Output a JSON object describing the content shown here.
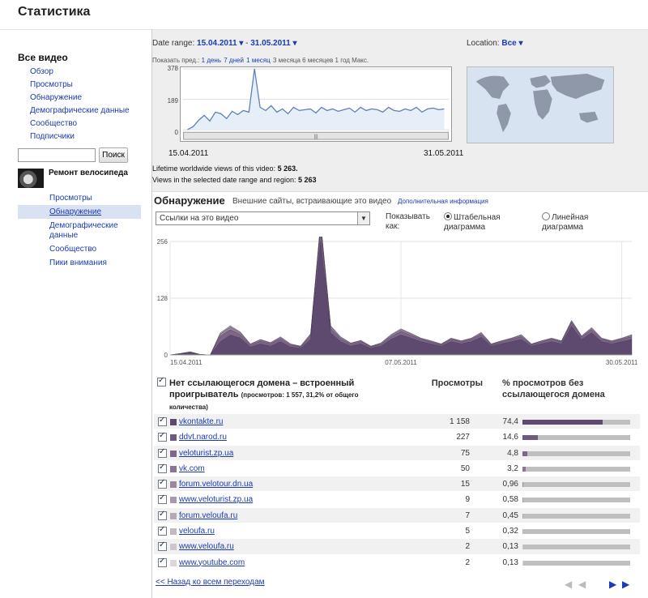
{
  "page_title": "Статистика",
  "sidebar": {
    "heading": "Все видео",
    "items": [
      "Обзор",
      "Просмотры",
      "Обнаружение",
      "Демографические данные",
      "Сообщество",
      "Подписчики"
    ],
    "search_placeholder": "",
    "search_button": "Поиск",
    "video_title": "Ремонт велосипеда",
    "sub_items": [
      "Просмотры",
      "Обнаружение",
      "Демографические данные",
      "Сообщество",
      "Пики внимания"
    ],
    "active_sub": "Обнаружение"
  },
  "top": {
    "date_range_label": "Date range:",
    "date_from": "15.04.2011",
    "date_sep": " - ",
    "date_to": "31.05.2011",
    "location_label": "Location:",
    "location_value": "Все",
    "preset_label": "Показать пред.:",
    "presets": [
      "1 день",
      "7 дней",
      "1 месяц"
    ],
    "presets_plain": "3 месяца 6 месяцев 1 год Макс.",
    "spark_y": [
      "378",
      "189",
      "0"
    ],
    "spark_values": [
      2,
      20,
      60,
      90,
      55,
      110,
      100,
      70,
      115,
      95,
      120,
      110,
      378,
      140,
      120,
      150,
      110,
      130,
      100,
      140,
      120,
      125,
      130,
      105,
      140,
      120,
      130,
      115,
      125,
      135,
      110,
      140,
      120,
      130,
      125,
      110,
      140,
      120,
      115,
      130,
      120,
      140,
      110,
      130,
      135,
      125,
      130
    ],
    "date_left": "15.04.2011",
    "date_right": "31.05.2011",
    "lifetime_label": "Lifetime worldwide views of this video:",
    "lifetime_value": "5 263.",
    "inrange_label": "Views in the selected date range and region:",
    "inrange_value": "5 263"
  },
  "discovery": {
    "title": "Обнаружение",
    "subtitle": "Внешние сайты, встраивающие это видео",
    "more_link": "Дополнительная информация",
    "select_value": "Ссылки на это видео",
    "show_as": "Показывать как:",
    "opt_stacked": "Штабельная диаграмма",
    "opt_line": "Линейная диаграмма"
  },
  "chart_data": {
    "type": "area",
    "stacked": true,
    "y_ticks": [
      "256",
      "128",
      "0"
    ],
    "ylim": [
      0,
      256
    ],
    "x_labels": [
      "15.04.2011",
      "07.05.2011",
      "30.05.2011"
    ],
    "colors": [
      "#5e4a6e",
      "#7d6689",
      "#9a889f",
      "#b1a5b3"
    ],
    "series": [
      {
        "values": [
          0,
          2,
          4,
          1,
          0,
          30,
          45,
          38,
          18,
          25,
          20,
          30,
          18,
          15,
          35,
          256,
          50,
          30,
          20,
          25,
          15,
          20,
          35,
          45,
          38,
          30,
          25,
          20,
          30,
          25,
          30,
          40,
          20,
          25,
          30,
          35,
          20,
          25,
          30,
          25,
          65,
          35,
          50,
          30,
          25,
          30,
          35
        ]
      },
      {
        "values": [
          0,
          1,
          2,
          0,
          0,
          12,
          12,
          8,
          4,
          6,
          5,
          6,
          4,
          3,
          8,
          30,
          10,
          6,
          4,
          5,
          3,
          4,
          6,
          8,
          6,
          5,
          4,
          3,
          5,
          4,
          5,
          6,
          3,
          4,
          5,
          6,
          3,
          4,
          5,
          4,
          8,
          5,
          7,
          5,
          4,
          5,
          6
        ]
      },
      {
        "values": [
          0,
          0,
          1,
          0,
          0,
          5,
          6,
          4,
          2,
          3,
          2,
          3,
          2,
          1,
          3,
          10,
          4,
          3,
          2,
          2,
          1,
          2,
          3,
          4,
          3,
          2,
          2,
          1,
          2,
          2,
          2,
          3,
          1,
          2,
          2,
          3,
          1,
          2,
          2,
          2,
          3,
          2,
          3,
          2,
          2,
          2,
          3
        ]
      },
      {
        "values": [
          0,
          0,
          0,
          0,
          0,
          3,
          3,
          2,
          1,
          1,
          1,
          2,
          1,
          1,
          2,
          6,
          2,
          2,
          1,
          1,
          1,
          1,
          2,
          2,
          2,
          1,
          1,
          1,
          1,
          1,
          1,
          2,
          1,
          1,
          1,
          2,
          1,
          1,
          1,
          1,
          2,
          1,
          2,
          1,
          1,
          1,
          2
        ]
      }
    ]
  },
  "table": {
    "header_domain": "Нет ссылающегося домена – встроенный проигрыватель",
    "header_domain_small": "(просмотров: 1 557, 31,2% от общего количества)",
    "header_views": "Просмотры",
    "header_pct": "% просмотров без ссылающегося домена",
    "rows": [
      {
        "domain": "vkontakte.ru",
        "views": "1 158",
        "pct": "74,4",
        "pct_value": 74.4,
        "color": "#5e4a6e"
      },
      {
        "domain": "ddvt.narod.ru",
        "views": "227",
        "pct": "14,6",
        "pct_value": 14.6,
        "color": "#6e5a7d"
      },
      {
        "domain": "veloturist.zp.ua",
        "views": "75",
        "pct": "4,8",
        "pct_value": 4.8,
        "color": "#7d6689"
      },
      {
        "domain": "vk.com",
        "views": "50",
        "pct": "3,2",
        "pct_value": 3.2,
        "color": "#8a7694"
      },
      {
        "domain": "forum.velotour.dn.ua",
        "views": "15",
        "pct": "0,96",
        "pct_value": 0.96,
        "color": "#9a889f"
      },
      {
        "domain": "www.veloturist.zp.ua",
        "views": "9",
        "pct": "0,58",
        "pct_value": 0.58,
        "color": "#a898ab"
      },
      {
        "domain": "forum.veloufa.ru",
        "views": "7",
        "pct": "0,45",
        "pct_value": 0.45,
        "color": "#b5a8b7"
      },
      {
        "domain": "veloufa.ru",
        "views": "5",
        "pct": "0,32",
        "pct_value": 0.32,
        "color": "#c2b8c3"
      },
      {
        "domain": "www.veloufa.ru",
        "views": "2",
        "pct": "0,13",
        "pct_value": 0.13,
        "color": "#cec6cf"
      },
      {
        "domain": "www.youtube.com",
        "views": "2",
        "pct": "0,13",
        "pct_value": 0.13,
        "color": "#dcd6dc"
      }
    ]
  },
  "footer": {
    "back_link": "<< Назад ко всем переходам",
    "pager_first": "◀",
    "pager_prev": "◀",
    "pager_next": "▶",
    "pager_last": "▶"
  }
}
